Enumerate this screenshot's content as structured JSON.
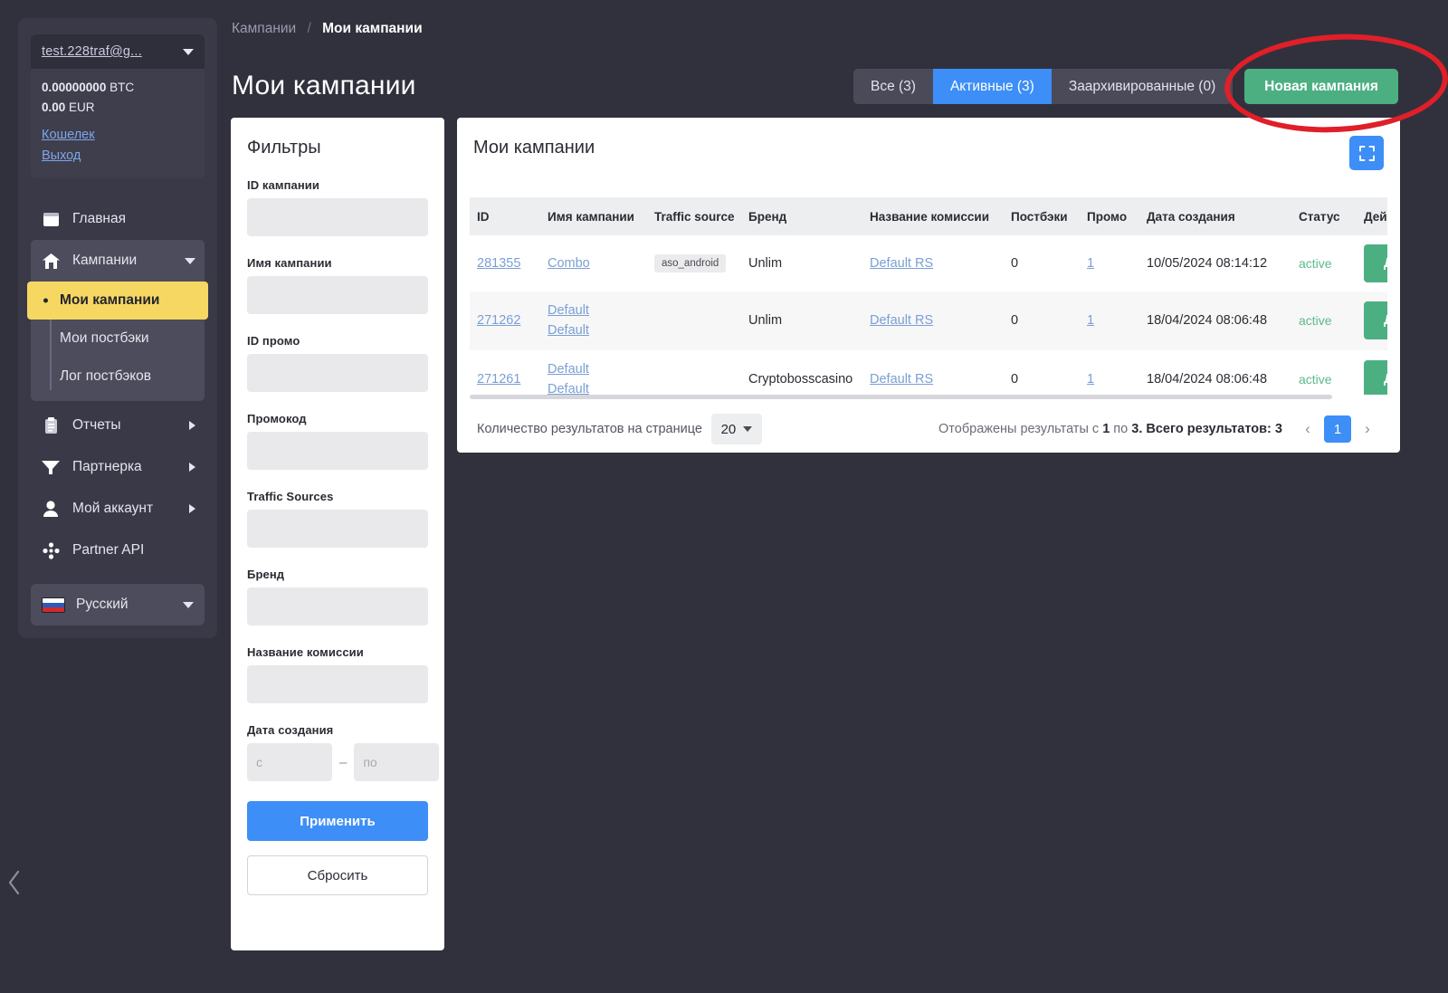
{
  "sidebar": {
    "account": {
      "email": "test.228traf@g...",
      "balances": [
        {
          "amount": "0.00000000",
          "currency": "BTC"
        },
        {
          "amount": "0.00",
          "currency": "EUR"
        }
      ],
      "links": [
        {
          "label": "Кошелек"
        },
        {
          "label": "Выход"
        }
      ]
    },
    "nav": [
      {
        "label": "Главная",
        "icon": "window-icon"
      },
      {
        "label": "Кампании",
        "icon": "home-icon"
      },
      {
        "label": "Отчеты",
        "icon": "clipboard-icon"
      },
      {
        "label": "Партнерка",
        "icon": "funnel-icon"
      },
      {
        "label": "Мой аккаунт",
        "icon": "user-icon"
      },
      {
        "label": "Partner API",
        "icon": "nodes-icon"
      }
    ],
    "submenu": [
      {
        "label": "Мои кампании",
        "active": true
      },
      {
        "label": "Мои постбэки",
        "active": false
      },
      {
        "label": "Лог постбэков",
        "active": false
      }
    ],
    "language": {
      "label": "Русский",
      "flag": "ru-flag-icon"
    }
  },
  "header": {
    "breadcrumb": {
      "parent": "Кампании",
      "separator": "/",
      "current": "Мои кампании"
    },
    "title": "Мои кампании",
    "tabs": [
      {
        "label": "Все (3)",
        "active": false
      },
      {
        "label": "Активные (3)",
        "active": true
      },
      {
        "label": "Заархивированные (0)",
        "active": false
      }
    ],
    "new_campaign_label": "Новая кампания"
  },
  "filters": {
    "title": "Фильтры",
    "fields": [
      {
        "label": "ID кампании",
        "value": "",
        "placeholder": ""
      },
      {
        "label": "Имя кампании",
        "value": "",
        "placeholder": ""
      },
      {
        "label": "ID промо",
        "value": "",
        "placeholder": ""
      },
      {
        "label": "Промокод",
        "value": "",
        "placeholder": ""
      },
      {
        "label": "Traffic Sources",
        "value": "",
        "placeholder": ""
      },
      {
        "label": "Бренд",
        "value": "",
        "placeholder": ""
      },
      {
        "label": "Название комиссии",
        "value": "",
        "placeholder": ""
      }
    ],
    "date": {
      "label": "Дата создания",
      "from_placeholder": "с",
      "to_placeholder": "по",
      "from_value": "",
      "to_value": "",
      "dash": "–"
    },
    "apply_label": "Применить",
    "reset_label": "Сбросить"
  },
  "table": {
    "title": "Мои кампании",
    "columns": [
      "ID",
      "Имя кампании",
      "Traffic source",
      "Бренд",
      "Название комиссии",
      "Постбэки",
      "Промо",
      "Дата создания",
      "Статус",
      "Действия"
    ],
    "rows": [
      {
        "id": "281355",
        "name": [
          "Combo"
        ],
        "traffic_source": "aso_android",
        "brand": "Unlim",
        "commission": "Default RS",
        "postbacks": "0",
        "promo": "1",
        "created": "10/05/2024 08:14:12",
        "status": "active",
        "action": "Добавить"
      },
      {
        "id": "271262",
        "name": [
          "Default",
          "Default"
        ],
        "traffic_source": "",
        "brand": "Unlim",
        "commission": "Default RS",
        "postbacks": "0",
        "promo": "1",
        "created": "18/04/2024 08:06:48",
        "status": "active",
        "action": "Добавить"
      },
      {
        "id": "271261",
        "name": [
          "Default",
          "Default"
        ],
        "traffic_source": "",
        "brand": "Cryptobosscasino",
        "commission": "Default RS",
        "postbacks": "0",
        "promo": "1",
        "created": "18/04/2024 08:06:48",
        "status": "active",
        "action": "Добавить"
      }
    ]
  },
  "pagination": {
    "perpage_label": "Количество результатов на странице",
    "perpage_value": "20",
    "results_prefix": "Отображены результаты с ",
    "results_from": "1",
    "results_mid": " по ",
    "results_to": "3",
    "results_total_label": ". Всего результатов: ",
    "results_total": "3",
    "prev": "‹",
    "next": "›",
    "current_page": "1"
  },
  "colors": {
    "accent_blue": "#3d8ef7",
    "accent_green": "#4caf82",
    "highlight_yellow": "#f5d762",
    "sidebar_bg": "#393947",
    "page_bg": "#31313d",
    "annotation_red": "#e01f28",
    "status_green": "#5bb98c"
  }
}
